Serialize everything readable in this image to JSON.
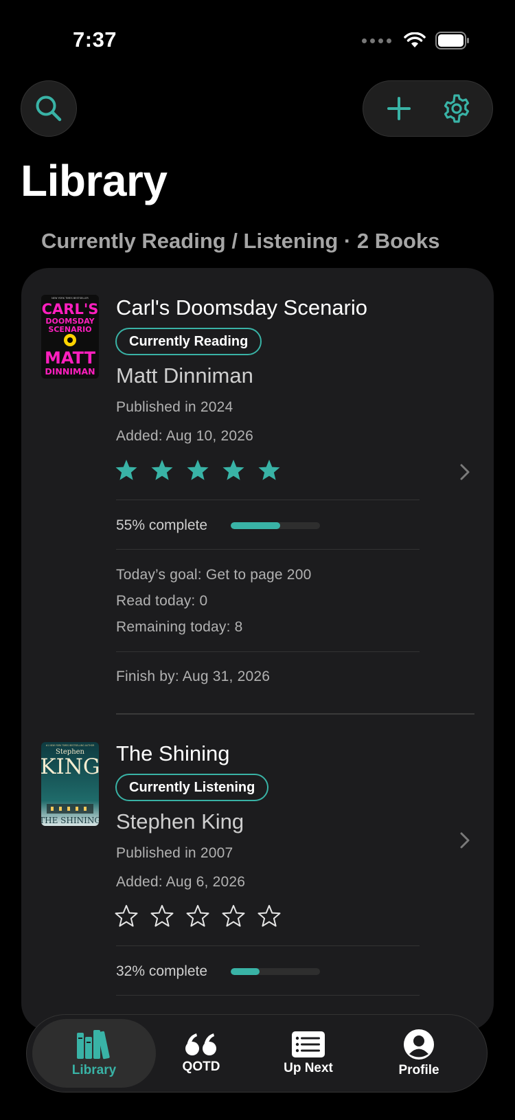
{
  "status": {
    "time": "7:37"
  },
  "header": {
    "title": "Library"
  },
  "section": {
    "header": "Currently Reading / Listening · 2 Books"
  },
  "colors": {
    "accent": "#39b3a6",
    "background": "#000000",
    "card": "#1c1c1e"
  },
  "books": [
    {
      "title": "Carl's Doomsday Scenario",
      "status": "Currently Reading",
      "author": "Matt Dinniman",
      "published": "Published in 2024",
      "added": "Added: Aug 10, 2026",
      "rating": 5,
      "progress_text": "55% complete",
      "progress": 0.55,
      "goal": "Today’s goal: Get to page 200",
      "read_today": "Read today: 0",
      "remaining": "Remaining today: 8",
      "finish_by": "Finish by: Aug 31, 2026",
      "cover": {
        "line1": "CARL'S",
        "line2": "DOOMSDAY",
        "line3": "SCENARIO",
        "line4": "MATT",
        "line5": "DINNIMAN",
        "top": "NEW YORK TIMES BESTSELLER"
      }
    },
    {
      "title": "The Shining",
      "status": "Currently Listening",
      "author": "Stephen King",
      "published": "Published in 2007",
      "added": "Added: Aug 6, 2026",
      "rating": 0,
      "progress_text": "32% complete",
      "progress": 0.32,
      "cover": {
        "line1": "Stephen",
        "line2": "KING",
        "line3": "THE SHINING",
        "top": "#1 NEW YORK TIMES BESTSELLING AUTHOR"
      }
    }
  ],
  "tabs": [
    {
      "label": "Library",
      "icon": "books-icon",
      "active": true
    },
    {
      "label": "QOTD",
      "icon": "quote-icon",
      "active": false
    },
    {
      "label": "Up Next",
      "icon": "list-icon",
      "active": false
    },
    {
      "label": "Profile",
      "icon": "person-icon",
      "active": false
    }
  ]
}
